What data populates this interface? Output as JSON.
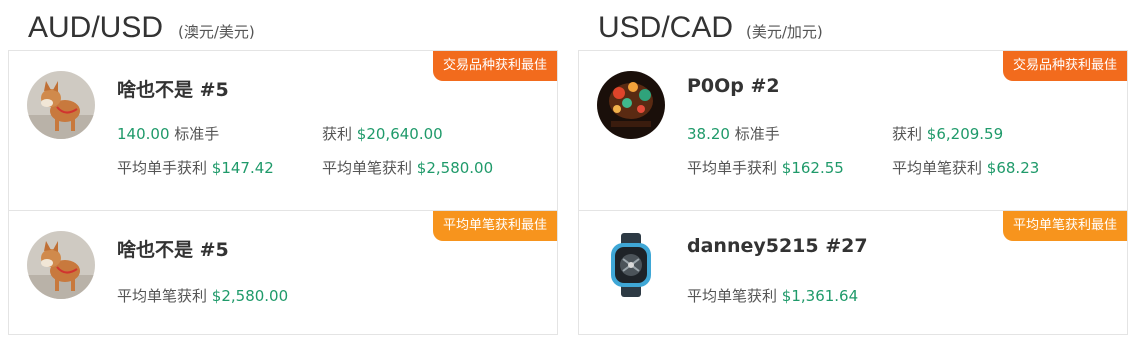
{
  "pairs": [
    {
      "title": "AUD/USD",
      "subtitle": "(澳元/美元)",
      "cards": [
        {
          "badge": "交易品种获利最佳",
          "name": "啥也不是 #5",
          "lots_value": "140.00",
          "lots_label": "标准手",
          "profit_label": "获利",
          "profit_value": "$20,640.00",
          "avg_lot_label": "平均单手获利",
          "avg_lot_value": "$147.42",
          "avg_trade_label": "平均单笔获利",
          "avg_trade_value": "$2,580.00"
        },
        {
          "badge": "平均单笔获利最佳",
          "name": "啥也不是 #5",
          "avg_trade_label": "平均单笔获利",
          "avg_trade_value": "$2,580.00"
        }
      ]
    },
    {
      "title": "USD/CAD",
      "subtitle": "(美元/加元)",
      "cards": [
        {
          "badge": "交易品种获利最佳",
          "name": "P0Op #2",
          "lots_value": "38.20",
          "lots_label": "标准手",
          "profit_label": "获利",
          "profit_value": "$6,209.59",
          "avg_lot_label": "平均单手获利",
          "avg_lot_value": "$162.55",
          "avg_trade_label": "平均单笔获利",
          "avg_trade_value": "$68.23"
        },
        {
          "badge": "平均单笔获利最佳",
          "name": "danney5215 #27",
          "avg_trade_label": "平均单笔获利",
          "avg_trade_value": "$1,361.64"
        }
      ]
    }
  ],
  "colors": {
    "badge_best": "#f26b1d",
    "badge_avg": "#f7941d",
    "value_green": "#1f9a6a"
  },
  "icons": {
    "avatar_dog": "dog-photo-avatar",
    "avatar_lanterns": "lanterns-photo-avatar",
    "avatar_watch": "watch-photo-avatar"
  }
}
